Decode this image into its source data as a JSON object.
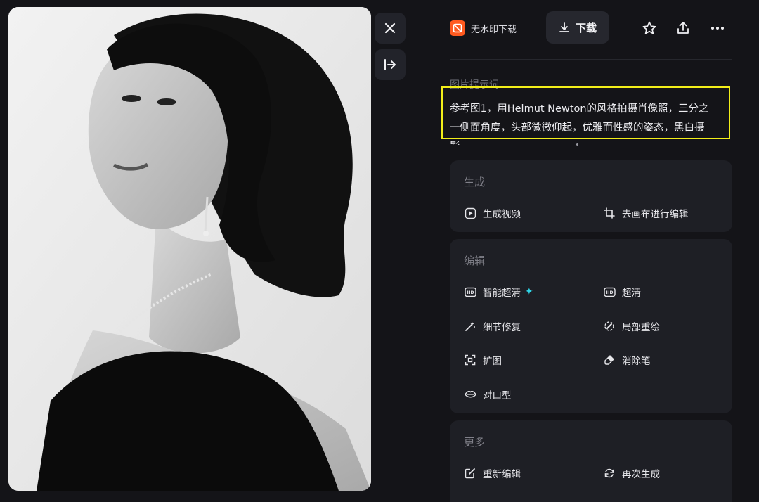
{
  "toolbar": {
    "no_watermark_label": "无水印下载",
    "download_label": "下载"
  },
  "prompt": {
    "title": "图片提示词",
    "line1": "参考图1，用Helmut Newton的风格拍摄肖像照，三分之",
    "line2": "一侧面角度，头部微微仰起，优雅而性感的姿态，黑白摄",
    "line3": "影"
  },
  "sections": {
    "generate": {
      "title": "生成",
      "items": [
        "生成视频",
        "去画布进行编辑"
      ]
    },
    "edit": {
      "title": "编辑",
      "items": [
        "智能超清",
        "超清",
        "细节修复",
        "局部重绘",
        "扩图",
        "消除笔",
        "对口型"
      ]
    },
    "more": {
      "title": "更多",
      "items": [
        "重新编辑",
        "再次生成"
      ]
    }
  },
  "colors": {
    "accent_orange": "#ff5a1f",
    "highlight": "#f2ee19",
    "sparkle": "#2fd6e8"
  }
}
